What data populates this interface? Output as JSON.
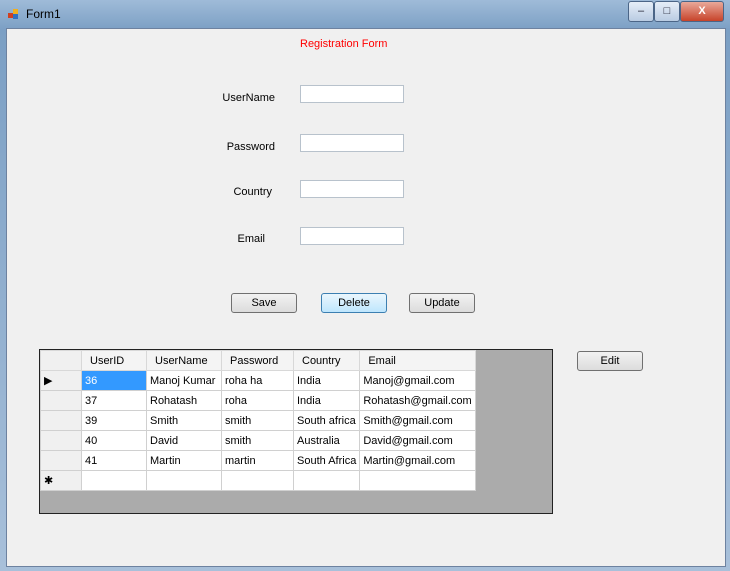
{
  "window": {
    "title": "Form1",
    "minimize": "–",
    "maximize": "□",
    "close": "X"
  },
  "form": {
    "heading": "Registration Form",
    "heading_color": "#ff0000",
    "fields": [
      {
        "label": "UserName",
        "value": ""
      },
      {
        "label": "Password",
        "value": ""
      },
      {
        "label": "Country",
        "value": ""
      },
      {
        "label": "Email",
        "value": ""
      }
    ],
    "buttons": {
      "save": "Save",
      "delete": "Delete",
      "update": "Update",
      "edit": "Edit"
    }
  },
  "grid": {
    "columns": [
      "UserID",
      "UserName",
      "Password",
      "Country",
      "Email"
    ],
    "rows": [
      [
        "36",
        "Manoj Kumar",
        "roha ha",
        "India",
        "Manoj@gmail.com"
      ],
      [
        "37",
        "Rohatash",
        "roha",
        "India",
        "Rohatash@gmail.com"
      ],
      [
        "39",
        "Smith",
        "smith",
        "South africa",
        "Smith@gmail.com"
      ],
      [
        "40",
        "David",
        "smith",
        "Australia",
        "David@gmail.com"
      ],
      [
        "41",
        "Martin",
        "martin",
        "South Africa",
        "Martin@gmail.com"
      ]
    ],
    "current_row_marker": "▶",
    "new_row_marker": "✱"
  }
}
